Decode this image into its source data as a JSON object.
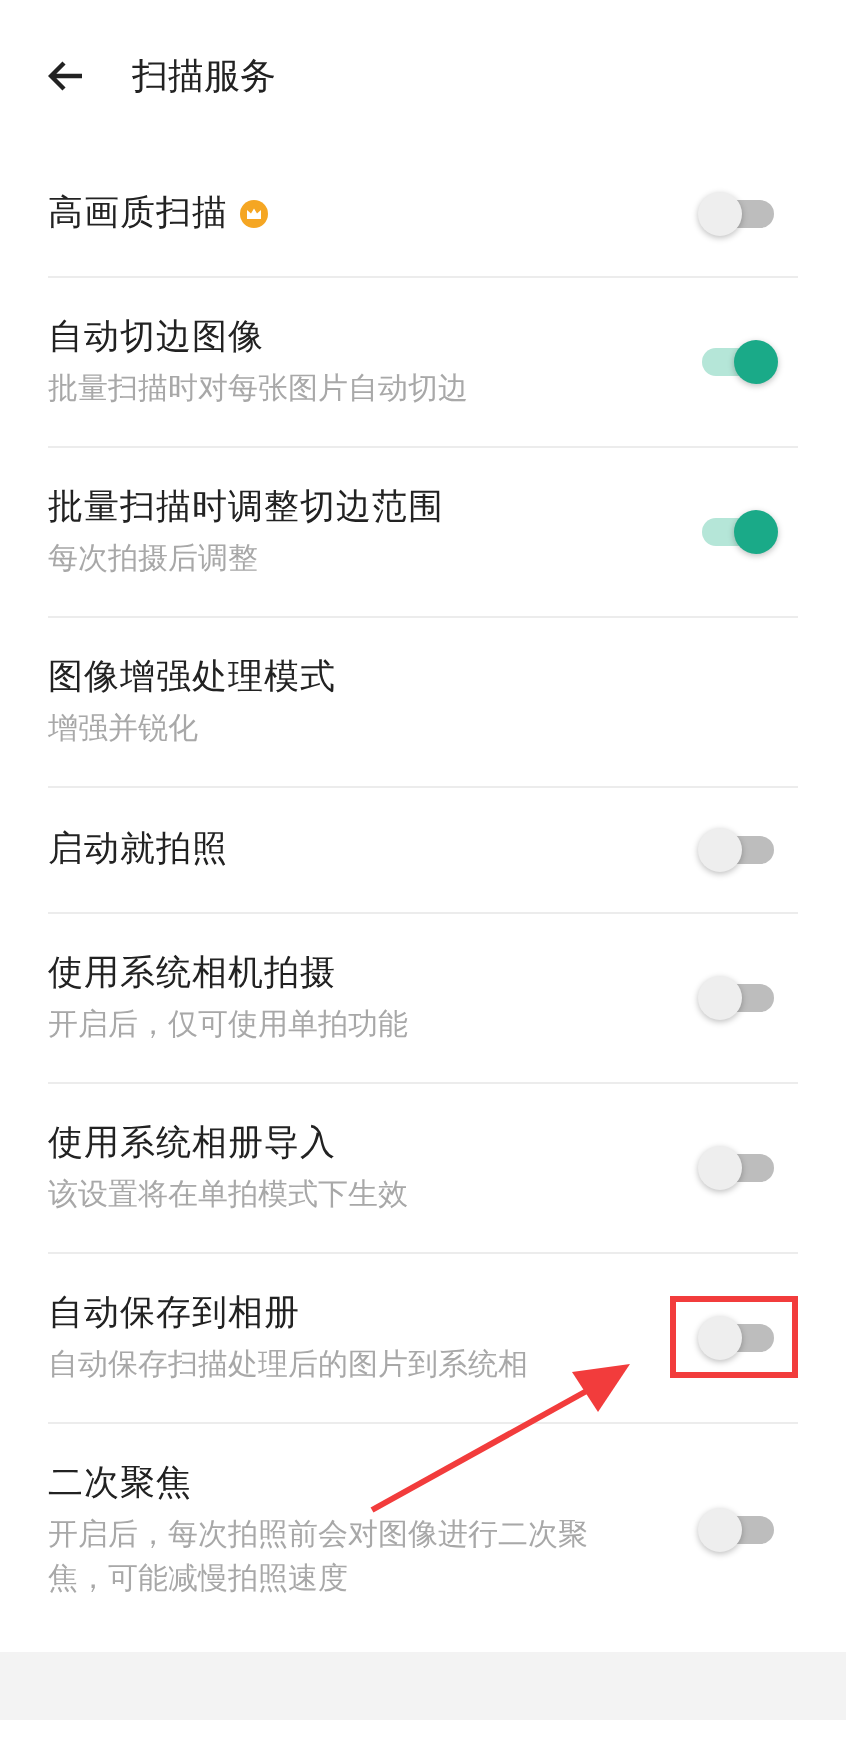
{
  "header": {
    "title": "扫描服务"
  },
  "rows": [
    {
      "kind": "toggle",
      "title": "高画质扫描",
      "premium": true,
      "on": false,
      "highlighted": false
    },
    {
      "kind": "toggle",
      "title": "自动切边图像",
      "subtitle": "批量扫描时对每张图片自动切边",
      "premium": false,
      "on": true,
      "highlighted": false
    },
    {
      "kind": "toggle",
      "title": "批量扫描时调整切边范围",
      "subtitle": "每次拍摄后调整",
      "premium": false,
      "on": true,
      "highlighted": false
    },
    {
      "kind": "value",
      "title": "图像增强处理模式",
      "subtitle": "增强并锐化",
      "premium": false,
      "highlighted": false
    },
    {
      "kind": "toggle",
      "title": "启动就拍照",
      "premium": false,
      "on": false,
      "highlighted": false
    },
    {
      "kind": "toggle",
      "title": "使用系统相机拍摄",
      "subtitle": "开启后，仅可使用单拍功能",
      "premium": false,
      "on": false,
      "highlighted": false
    },
    {
      "kind": "toggle",
      "title": "使用系统相册导入",
      "subtitle": "该设置将在单拍模式下生效",
      "premium": false,
      "on": false,
      "highlighted": false
    },
    {
      "kind": "toggle",
      "title": "自动保存到相册",
      "subtitle": "自动保存扫描处理后的图片到系统相",
      "premium": false,
      "on": false,
      "highlighted": true
    },
    {
      "kind": "toggle",
      "title": "二次聚焦",
      "subtitle": "开启后，每次拍照前会对图像进行二次聚焦，可能减慢拍照速度",
      "premium": false,
      "on": false,
      "highlighted": false
    }
  ]
}
